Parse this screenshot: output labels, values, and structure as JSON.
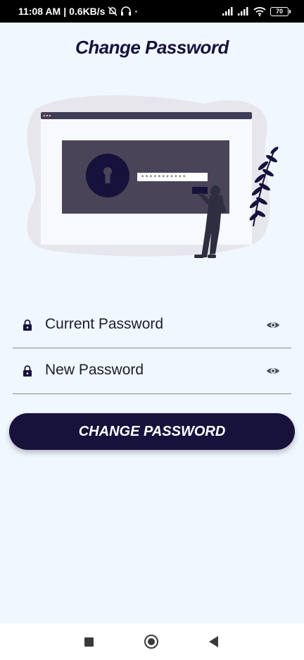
{
  "status_bar": {
    "time": "11:08 AM",
    "speed": "0.6KB/s",
    "battery": "70"
  },
  "header": {
    "title": "Change Password"
  },
  "illustration": {
    "password_mask": "***********"
  },
  "form": {
    "current_password": {
      "label": "Current Password"
    },
    "new_password": {
      "label": "New Password"
    },
    "submit_label": "CHANGE PASSWORD"
  },
  "colors": {
    "background": "#f1f7ff",
    "primary": "#16123c",
    "illustration_panel": "#4a4459"
  },
  "icons": {
    "field_leading": "lock-icon",
    "field_trailing": "eye-icon"
  }
}
